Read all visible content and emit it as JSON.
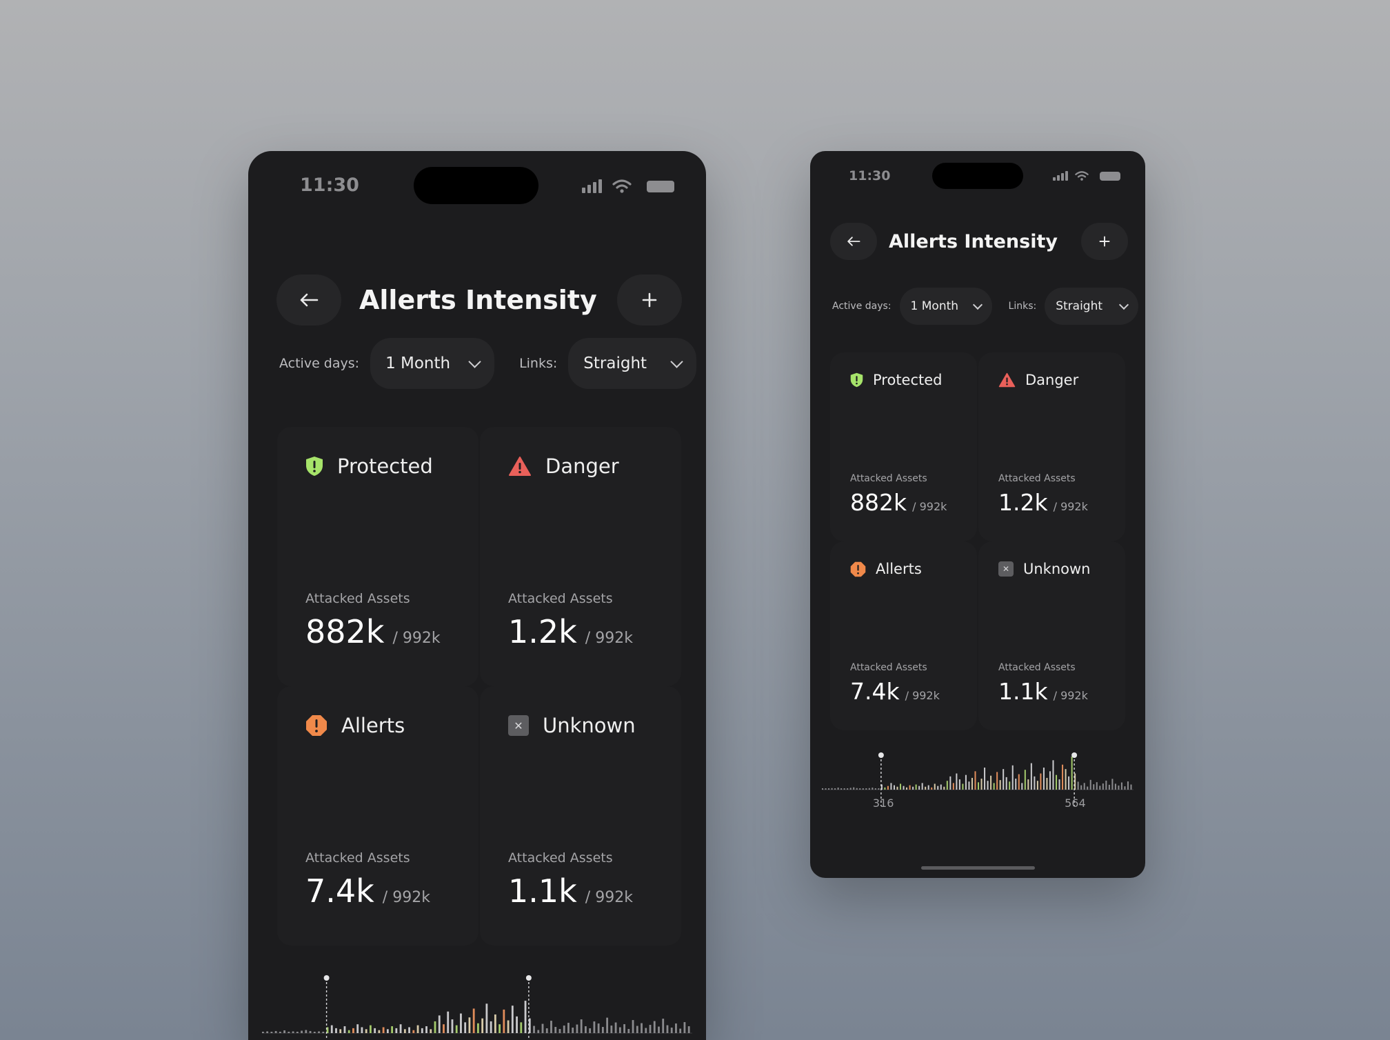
{
  "screens": [
    {
      "id": "large",
      "status": {
        "time": "11:30"
      },
      "header": {
        "title": "Allerts Intensity",
        "back_icon": "arrow-left-icon",
        "add_icon": "plus-icon"
      },
      "filters": {
        "active_days_label": "Active days:",
        "active_days_value": "1 Month",
        "links_label": "Links:",
        "links_value": "Straight"
      },
      "cards": [
        {
          "title": "Protected",
          "icon": "shield-icon",
          "icon_color": "#a6e36a",
          "caption": "Attacked Assets",
          "value": "882k",
          "total": "/ 992k"
        },
        {
          "title": "Danger",
          "icon": "warning-triangle-icon",
          "icon_color": "#e9605a",
          "caption": "Attacked Assets",
          "value": "1.2k",
          "total": "/ 992k"
        },
        {
          "title": "Allerts",
          "icon": "alert-octagon-icon",
          "icon_color": "#f0894a",
          "caption": "Attacked Assets",
          "value": "7.4k",
          "total": "/ 992k"
        },
        {
          "title": "Unknown",
          "icon": "close-square-icon",
          "icon_color": "#5d5d60",
          "caption": "Attacked Assets",
          "value": "1.1k",
          "total": "/ 992k"
        }
      ]
    },
    {
      "id": "small",
      "status": {
        "time": "11:30"
      },
      "header": {
        "title": "Allerts Intensity",
        "back_icon": "arrow-left-icon",
        "add_icon": "plus-icon"
      },
      "filters": {
        "active_days_label": "Active days:",
        "active_days_value": "1 Month",
        "links_label": "Links:",
        "links_value": "Straight"
      },
      "cards": [
        {
          "title": "Protected",
          "icon": "shield-icon",
          "icon_color": "#a6e36a",
          "caption": "Attacked Assets",
          "value": "882k",
          "total": "/ 992k"
        },
        {
          "title": "Danger",
          "icon": "warning-triangle-icon",
          "icon_color": "#e9605a",
          "caption": "Attacked Assets",
          "value": "1.2k",
          "total": "/ 992k"
        },
        {
          "title": "Allerts",
          "icon": "alert-octagon-icon",
          "icon_color": "#f0894a",
          "caption": "Attacked Assets",
          "value": "7.4k",
          "total": "/ 992k"
        },
        {
          "title": "Unknown",
          "icon": "close-square-icon",
          "icon_color": "#5d5d60",
          "caption": "Attacked Assets",
          "value": "1.1k",
          "total": "/ 992k"
        }
      ],
      "range": {
        "start_label": "316",
        "end_label": "564"
      }
    }
  ],
  "chart_data": {
    "type": "bar",
    "range_selection": {
      "start": 316,
      "end": 564
    },
    "series": [
      {
        "values": [
          3,
          5,
          2,
          6,
          4,
          8,
          3,
          5,
          4,
          7,
          9,
          6,
          4,
          5,
          3,
          6,
          8,
          5,
          4,
          7,
          3,
          5,
          9,
          6,
          4,
          8,
          5,
          3,
          6,
          4,
          7,
          5,
          9,
          4,
          6,
          3,
          8,
          5,
          7,
          4,
          12,
          18,
          9,
          22,
          14,
          8,
          20,
          11,
          16,
          25,
          10,
          15,
          30,
          12,
          19,
          9,
          24,
          13,
          28,
          17,
          11,
          33,
          15,
          21,
          9,
          27,
          14,
          36,
          18,
          12,
          22,
          30,
          16,
          25,
          40,
          20,
          14,
          34,
          28,
          18,
          45,
          22,
          31,
          17,
          26,
          12,
          38,
          21,
          29,
          15,
          24,
          35,
          19,
          42,
          23,
          16,
          28,
          13,
          32,
          20
        ],
        "colors_used": [
          "#8a8a8d",
          "#d6c9a8",
          "#e08c5a",
          "#a3c96b"
        ]
      }
    ]
  }
}
